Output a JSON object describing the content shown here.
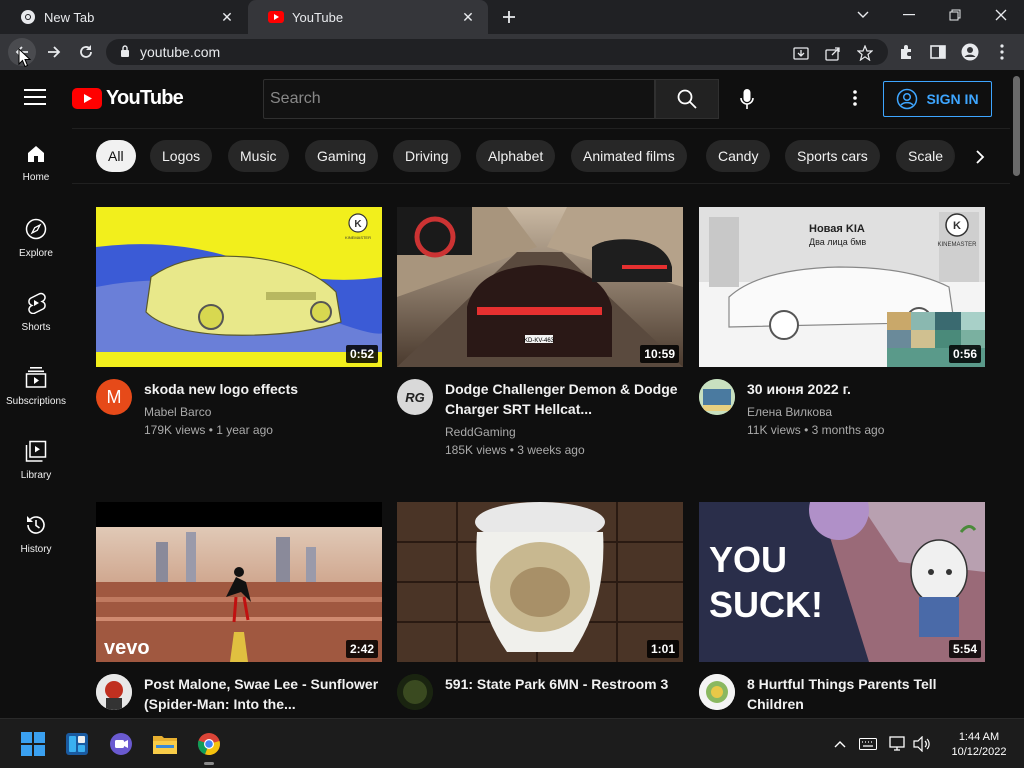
{
  "browser": {
    "tabs": [
      {
        "title": "New Tab",
        "favicon": "chrome-icon"
      },
      {
        "title": "YouTube",
        "favicon": "youtube-icon",
        "active": true
      }
    ],
    "url": "youtube.com"
  },
  "masthead": {
    "logo_text": "YouTube",
    "search_placeholder": "Search",
    "sign_in_label": "SIGN IN"
  },
  "guide": [
    {
      "label": "Home",
      "icon": "home-icon"
    },
    {
      "label": "Explore",
      "icon": "compass-icon"
    },
    {
      "label": "Shorts",
      "icon": "shorts-icon"
    },
    {
      "label": "Subscriptions",
      "icon": "subscriptions-icon"
    },
    {
      "label": "Library",
      "icon": "library-icon"
    },
    {
      "label": "History",
      "icon": "history-icon"
    }
  ],
  "chips": [
    "All",
    "Logos",
    "Music",
    "Gaming",
    "Driving",
    "Alphabet",
    "Animated films",
    "Candy",
    "Sports cars",
    "Scale"
  ],
  "videos": [
    {
      "title": "skoda new logo effects",
      "channel": "Mabel Barco",
      "stats": "179K views • 1 year ago",
      "duration": "0:52",
      "avatar_letter": "M"
    },
    {
      "title": "Dodge Challenger Demon & Dodge Charger SRT Hellcat...",
      "channel": "ReddGaming",
      "stats": "185K views • 3 weeks ago",
      "duration": "10:59",
      "avatar_letter": "RG"
    },
    {
      "title": "30 июня 2022 г.",
      "channel": "Елена Вилкова",
      "stats": "11K views • 3 months ago",
      "duration": "0:56",
      "avatar_letter": ""
    },
    {
      "title": "Post Malone, Swae Lee - Sunflower (Spider-Man: Into the...",
      "channel": "",
      "stats": "",
      "duration": "2:42",
      "avatar_letter": ""
    },
    {
      "title": "591: State Park 6MN - Restroom 3",
      "channel": "",
      "stats": "",
      "duration": "1:01",
      "avatar_letter": ""
    },
    {
      "title": "8 Hurtful Things Parents Tell Children",
      "channel": "",
      "stats": "",
      "duration": "5:54",
      "avatar_letter": ""
    }
  ],
  "thumb_text": {
    "watermark": "KINEMASTER",
    "vevo": "vevo",
    "you": "YOU",
    "suck": "SUCK!",
    "plate": "KD-KV-463",
    "kia1": "Новая KIA",
    "kia2": "Два лица бмв"
  },
  "taskbar": {
    "time": "1:44 AM",
    "date": "10/12/2022"
  },
  "colors": {
    "youtube_red": "#ff0000",
    "accent_blue": "#3ea6ff",
    "background": "#0f0f0f"
  }
}
